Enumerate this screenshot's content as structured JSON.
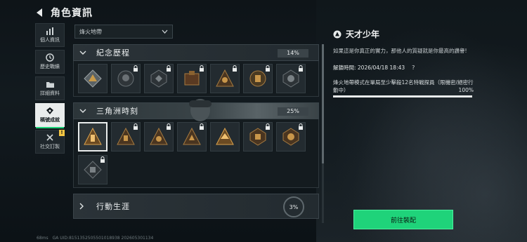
{
  "header": {
    "title": "角色資訊"
  },
  "nav": {
    "items": [
      {
        "label": "個人資訊",
        "icon": "bar-chart-icon"
      },
      {
        "label": "歷史戰績",
        "icon": "history-icon"
      },
      {
        "label": "詳細資料",
        "icon": "folder-icon"
      },
      {
        "label": "稱號成就",
        "icon": "achievement-icon",
        "active": true
      },
      {
        "label": "社交訂製",
        "icon": "tools-icon",
        "badge": "!"
      }
    ]
  },
  "filter": {
    "selected": "烽火地帶"
  },
  "sections": [
    {
      "name": "紀念歷程",
      "percent": "14%"
    },
    {
      "name": "三角洲時刻",
      "percent": "25%"
    },
    {
      "name": "行動生涯",
      "percent": "3%"
    }
  ],
  "detail": {
    "title": "天才少年",
    "description": "如果這是你真正的實力，那他人的質疑就是你最高的讚譽!",
    "unlock_label": "解鎖時間: 2026/04/18 18:43",
    "help_symbol": "?",
    "condition": "烽火地帶模式在單局至少擊殺12名特戰探員（限機密/絕密行動中）",
    "condition_percent": "100%",
    "progress": 1.0
  },
  "equip_button": "前往裝配",
  "footer": {
    "ping": "68ms",
    "uid": "GA UID:8151352505501018938 202605301134"
  },
  "colors": {
    "accent": "#1fd37a",
    "badge": "#f2c542"
  }
}
